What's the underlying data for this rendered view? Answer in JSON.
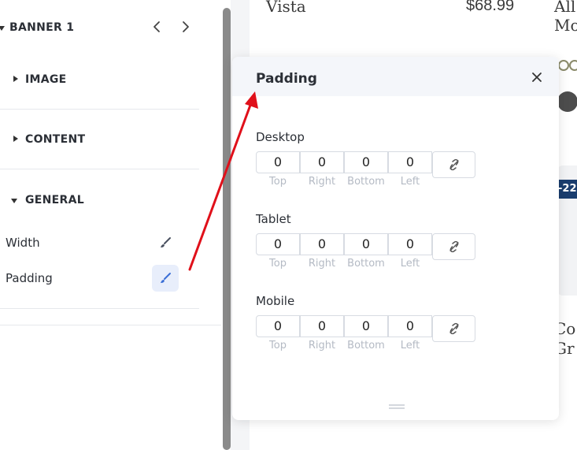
{
  "sidebar": {
    "banner_title": "BANNER 1",
    "sections": [
      {
        "label": "IMAGE"
      },
      {
        "label": "CONTENT"
      },
      {
        "label": "GENERAL"
      }
    ],
    "properties": [
      {
        "label": "Width"
      },
      {
        "label": "Padding"
      }
    ]
  },
  "content": {
    "product_name": "Vista",
    "product_price": "$68.99",
    "right_text_top": [
      "All",
      "Mo"
    ],
    "badge_text": "-22",
    "right_text_bottom": [
      "Co",
      "Gr"
    ]
  },
  "popup": {
    "title": "Padding",
    "devices": [
      {
        "label": "Desktop",
        "values": [
          "0",
          "0",
          "0",
          "0"
        ]
      },
      {
        "label": "Tablet",
        "values": [
          "0",
          "0",
          "0",
          "0"
        ]
      },
      {
        "label": "Mobile",
        "values": [
          "0",
          "0",
          "0",
          "0"
        ]
      }
    ],
    "sides": [
      "Top",
      "Right",
      "Bottom",
      "Left"
    ]
  },
  "colors": {
    "accent": "#3b6fd6",
    "arrow": "#e0101a",
    "badge": "#1a3d6e"
  }
}
